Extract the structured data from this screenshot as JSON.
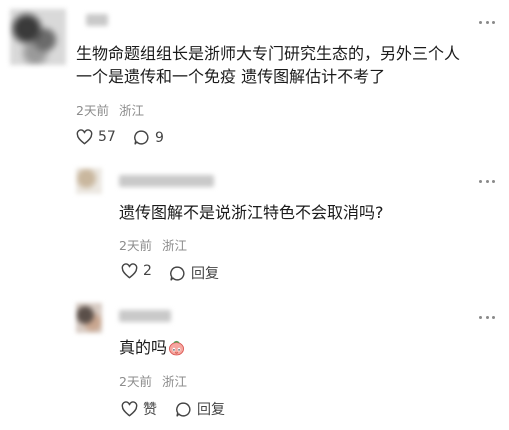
{
  "comments": [
    {
      "text_line1": "生物命题组组长是浙师大专门研究生态的，另外三个人",
      "text_line2": "一个是遗传和一个免疫 遗传图解估计不考了",
      "time": "2天前",
      "location": "浙江",
      "like_count": "57",
      "reply_count": "9"
    }
  ],
  "replies": [
    {
      "text": "遗传图解不是说浙江特色不会取消吗?",
      "time": "2天前",
      "location": "浙江",
      "like_count": "2",
      "reply_label": "回复"
    },
    {
      "text": "真的吗",
      "time": "2天前",
      "location": "浙江",
      "like_label": "赞",
      "reply_label": "回复"
    }
  ],
  "colors": {
    "text": "#1a1a1a",
    "meta": "#8c8c8c",
    "icon": "#444444"
  }
}
